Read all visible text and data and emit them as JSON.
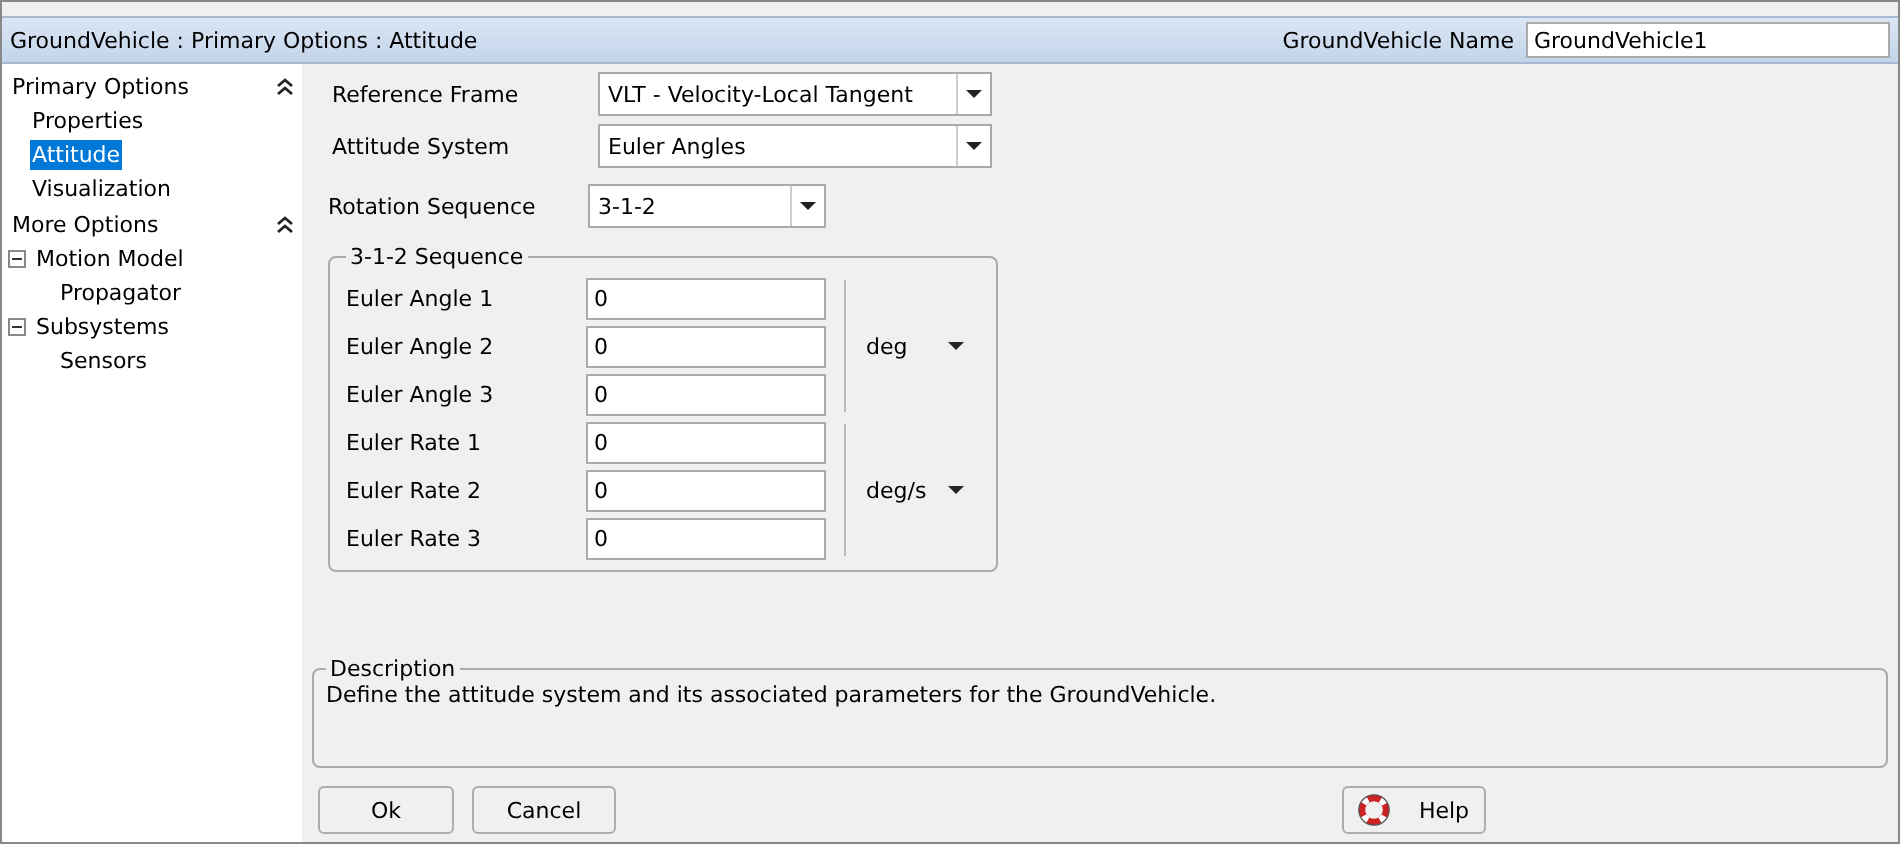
{
  "window": {
    "title": "GroundVehicle : Primary Options : Attitude"
  },
  "name_field": {
    "label": "GroundVehicle Name",
    "value": "GroundVehicle1"
  },
  "sidebar": {
    "sections": [
      {
        "title": "Primary Options",
        "items": [
          {
            "label": "Properties",
            "selected": false
          },
          {
            "label": "Attitude",
            "selected": true
          },
          {
            "label": "Visualization",
            "selected": false
          }
        ]
      },
      {
        "title": "More Options",
        "items": [
          {
            "label": "Motion Model",
            "expanded": true,
            "selected": false,
            "children": [
              {
                "label": "Propagator",
                "selected": false
              }
            ]
          },
          {
            "label": "Subsystems",
            "expanded": true,
            "selected": false,
            "children": [
              {
                "label": "Sensors",
                "selected": false
              }
            ]
          }
        ]
      }
    ]
  },
  "reference_frame": {
    "label": "Reference Frame",
    "value": "VLT - Velocity-Local Tangent"
  },
  "attitude_system": {
    "label": "Attitude System",
    "value": "Euler Angles"
  },
  "rotation_sequence": {
    "label": "Rotation Sequence",
    "value": "3-1-2"
  },
  "sequence_group": {
    "title": "3-1-2 Sequence",
    "groups": [
      {
        "unit": "deg",
        "fields": [
          {
            "label": "Euler Angle 1",
            "value": "0"
          },
          {
            "label": "Euler Angle 2",
            "value": "0"
          },
          {
            "label": "Euler Angle 3",
            "value": "0"
          }
        ]
      },
      {
        "unit": "deg/s",
        "fields": [
          {
            "label": "Euler Rate 1",
            "value": "0"
          },
          {
            "label": "Euler Rate 2",
            "value": "0"
          },
          {
            "label": "Euler Rate 3",
            "value": "0"
          }
        ]
      }
    ]
  },
  "description": {
    "title": "Description",
    "text": "Define the attitude system and its associated parameters for the GroundVehicle."
  },
  "buttons": [
    {
      "label": "Ok",
      "kind": "plain"
    },
    {
      "label": "Cancel",
      "kind": "plain"
    },
    {
      "label": "Help",
      "kind": "help"
    }
  ]
}
